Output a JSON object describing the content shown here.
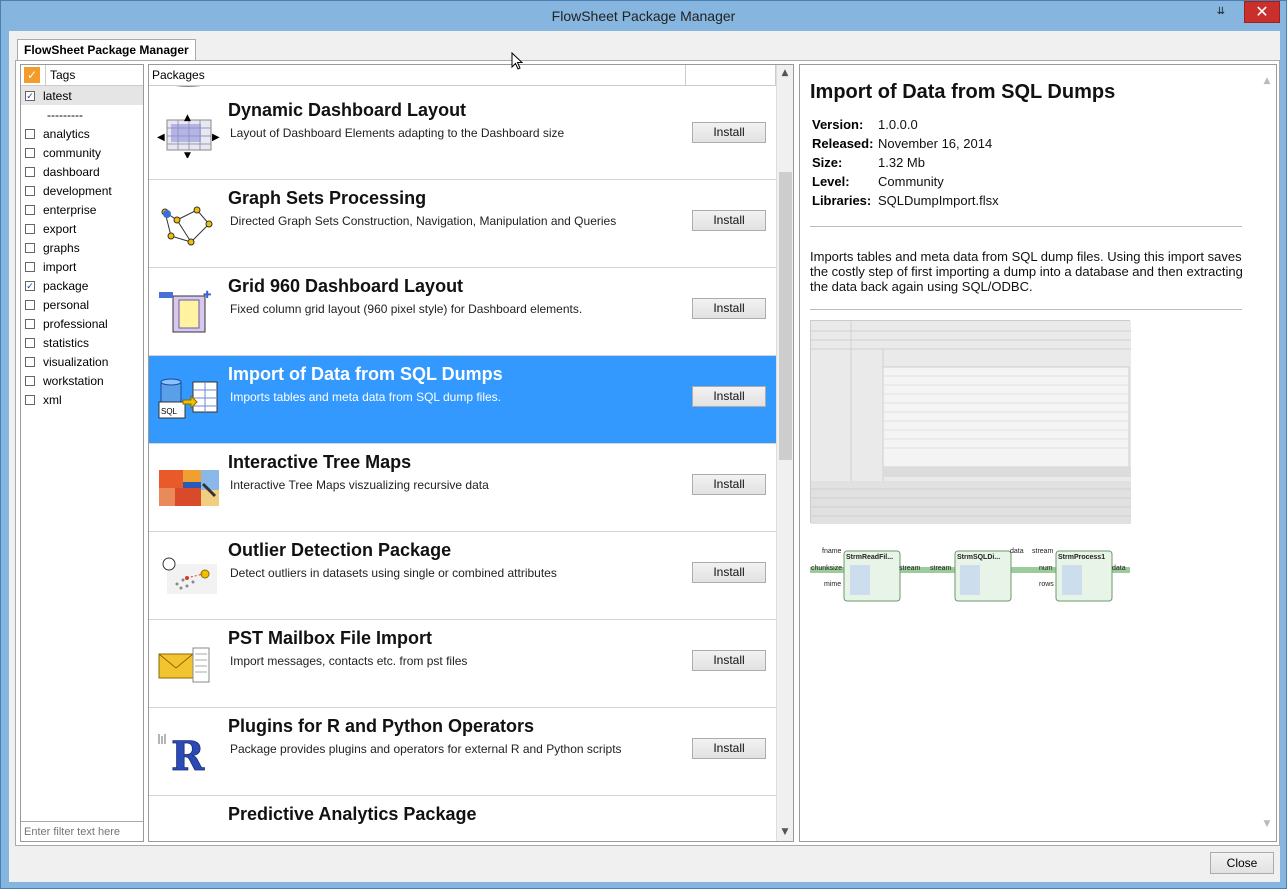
{
  "window": {
    "title": "FlowSheet Package Manager",
    "menu_glyph": "⇊",
    "close_glyph": "✕"
  },
  "tab": {
    "label": "FlowSheet Package Manager"
  },
  "tags": {
    "header": "Tags",
    "items": [
      {
        "label": "latest",
        "checked": true
      },
      {
        "label": "---------",
        "separator": true
      },
      {
        "label": "analytics",
        "checked": false
      },
      {
        "label": "community",
        "checked": false
      },
      {
        "label": "dashboard",
        "checked": false
      },
      {
        "label": "development",
        "checked": false
      },
      {
        "label": "enterprise",
        "checked": false
      },
      {
        "label": "export",
        "checked": false
      },
      {
        "label": "graphs",
        "checked": false
      },
      {
        "label": "import",
        "checked": false
      },
      {
        "label": "package",
        "checked": true
      },
      {
        "label": "personal",
        "checked": false
      },
      {
        "label": "professional",
        "checked": false
      },
      {
        "label": "statistics",
        "checked": false
      },
      {
        "label": "visualization",
        "checked": false
      },
      {
        "label": "workstation",
        "checked": false
      },
      {
        "label": "xml",
        "checked": false
      }
    ],
    "filter_placeholder": "Enter filter text here"
  },
  "packages": {
    "header": "Packages",
    "items": [
      {
        "name": "Dynamic Dashboard Layout",
        "desc": "Layout of Dashboard Elements adapting to the Dashboard size",
        "button": "Install",
        "icon": "dashboard-grid-icon"
      },
      {
        "name": "Graph Sets Processing",
        "desc": "Directed Graph Sets Construction, Navigation, Manipulation and Queries",
        "button": "Install",
        "icon": "graph-nodes-icon"
      },
      {
        "name": "Grid 960 Dashboard Layout",
        "desc": "Fixed column grid layout (960 pixel style) for Dashboard elements.",
        "button": "Install",
        "icon": "grid-960-icon"
      },
      {
        "name": "Import of Data from SQL Dumps",
        "desc": "Imports tables and meta data from SQL dump files.",
        "button": "Install",
        "icon": "sql-import-icon",
        "selected": true
      },
      {
        "name": "Interactive Tree Maps",
        "desc": "Interactive Tree Maps viszualizing recursive data",
        "button": "Install",
        "icon": "treemap-icon"
      },
      {
        "name": "Outlier Detection Package",
        "desc": "Detect outliers in datasets using single or combined attributes",
        "button": "Install",
        "icon": "outlier-icon"
      },
      {
        "name": "PST Mailbox File Import",
        "desc": "Import messages, contacts etc. from pst files",
        "button": "Install",
        "icon": "mailbox-icon"
      },
      {
        "name": "Plugins for R and Python Operators",
        "desc": "Package provides plugins and operators for external R and Python scripts",
        "button": "Install",
        "icon": "r-logo-icon"
      },
      {
        "name": "Predictive Analytics Package",
        "desc": "",
        "button": "",
        "icon": ""
      }
    ]
  },
  "detail": {
    "title": "Import of Data from SQL Dumps",
    "meta": [
      {
        "k": "Version:",
        "v": "1.0.0.0"
      },
      {
        "k": "Released:",
        "v": "November 16, 2014"
      },
      {
        "k": "Size:",
        "v": "1.32 Mb"
      },
      {
        "k": "Level:",
        "v": "Community"
      },
      {
        "k": "Libraries:",
        "v": "SQLDumpImport.flsx"
      }
    ],
    "about": "Imports tables and meta data from SQL dump files. Using this import saves the costly step of first importing a dump into a database and then extracting the data back again using SQL/ODBC.",
    "flow_nodes": [
      "StrmReadFil...",
      "StrmSQLDi...",
      "StrmProcess1"
    ],
    "flow_ports": [
      "fname",
      "chunksize",
      "mime",
      "stream",
      "stream",
      "data",
      "stream",
      "num",
      "rows",
      "data"
    ]
  },
  "footer": {
    "close_label": "Close"
  },
  "colors": {
    "selection": "#3399ff",
    "accent_checkbox": "#f39c2b"
  }
}
